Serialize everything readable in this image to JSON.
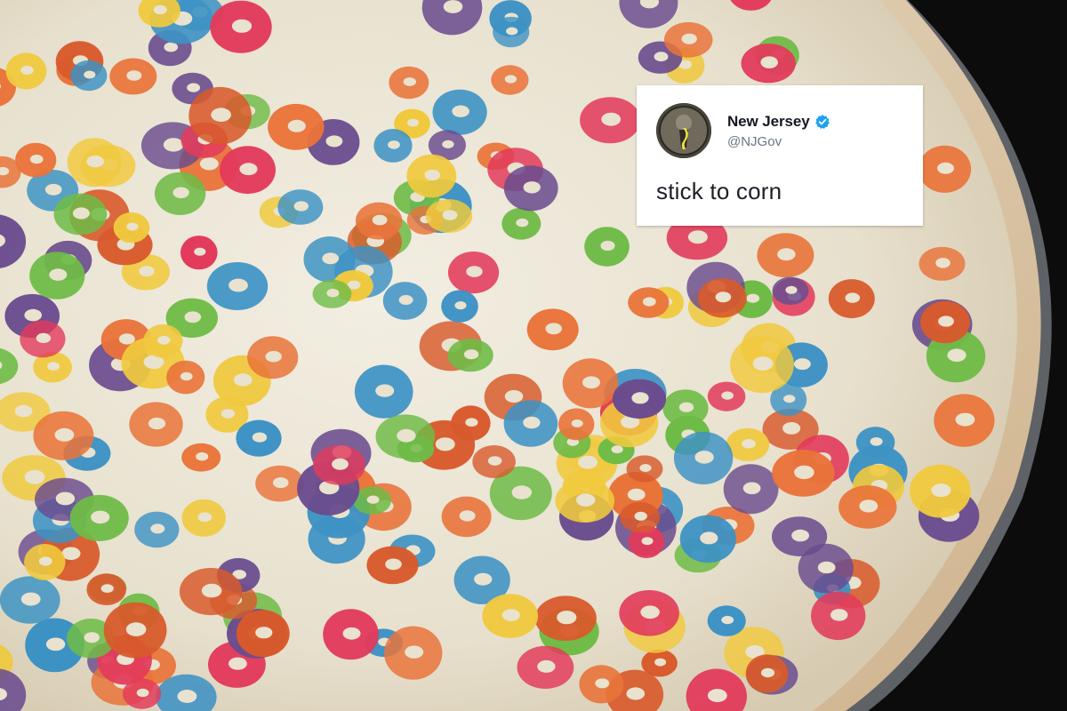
{
  "photo": {
    "subject": "cereal-pizza",
    "colors": {
      "background": "#0c0c0c",
      "cheese": "#ece6d6",
      "crust": "#d9c4a6",
      "cereal": [
        "#e9743a",
        "#f0c93e",
        "#6fbb47",
        "#3d92c4",
        "#6a4c8e",
        "#e23b5b",
        "#d85a2c"
      ]
    }
  },
  "tweet": {
    "display_name": "New Jersey",
    "handle": "@NJGov",
    "verified": true,
    "text": "stick to corn",
    "avatar_icon": "nj-seal-avatar",
    "verified_icon": "verified-badge-icon",
    "colors": {
      "card": "#ffffff",
      "name": "#141823",
      "handle": "#687684",
      "text": "#1c2127",
      "verified": "#1da1f2"
    }
  }
}
